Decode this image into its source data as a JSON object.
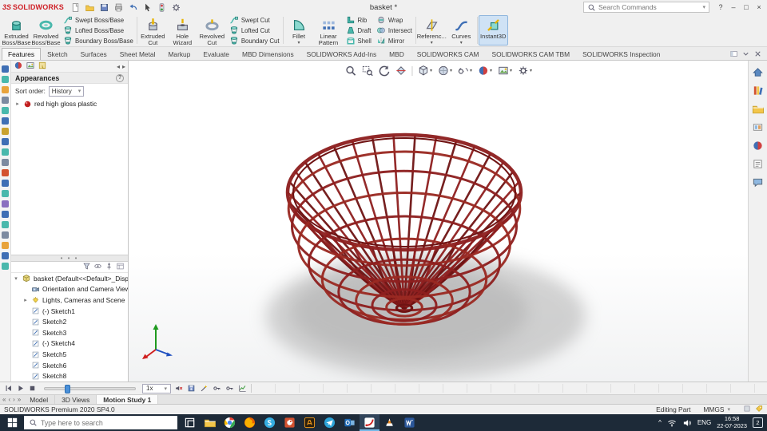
{
  "colors": {
    "basket": "#8e1f1f",
    "basket_dark": "#6f1313",
    "basket_mid": "#9a2a22",
    "shadow": "#a8a8a8",
    "taskbar": "#1d2a38",
    "accent_red": "#cf2027"
  },
  "titlebar": {
    "logo_prefix": "3S",
    "logo_text": "SOLIDWORKS",
    "doc_title": "basket *",
    "search_placeholder": "Search Commands",
    "menu_icons": [
      "new-document",
      "open",
      "save",
      "print",
      "undo",
      "select",
      "rebuild",
      "options"
    ],
    "window_buttons": [
      {
        "name": "help",
        "glyph": "?"
      },
      {
        "name": "minimize",
        "glyph": "–"
      },
      {
        "name": "maximize",
        "glyph": "□"
      },
      {
        "name": "close",
        "glyph": "×"
      }
    ]
  },
  "ribbon": {
    "groups": [
      {
        "type": "big",
        "label": "Extruded Boss/Base",
        "icon": "extruded-boss"
      },
      {
        "type": "big",
        "label": "Revolved Boss/Base",
        "icon": "revolved-boss"
      },
      {
        "type": "stack",
        "sep": true,
        "items": [
          {
            "label": "Swept Boss/Base",
            "icon": "swept-boss"
          },
          {
            "label": "Lofted Boss/Base",
            "icon": "lofted-boss"
          },
          {
            "label": "Boundary Boss/Base",
            "icon": "boundary-boss"
          }
        ]
      },
      {
        "type": "big",
        "label": "Extruded Cut",
        "icon": "extruded-cut",
        "arrow": true
      },
      {
        "type": "big",
        "label": "Hole Wizard",
        "icon": "hole-wizard",
        "arrow": true
      },
      {
        "type": "big",
        "label": "Revolved Cut",
        "icon": "revolved-cut",
        "arrow": true
      },
      {
        "type": "stack",
        "sep": true,
        "items": [
          {
            "label": "Swept Cut",
            "icon": "swept-cut"
          },
          {
            "label": "Lofted Cut",
            "icon": "lofted-cut"
          },
          {
            "label": "Boundary Cut",
            "icon": "boundary-cut"
          }
        ]
      },
      {
        "type": "big",
        "label": "Fillet",
        "icon": "fillet",
        "arrow": true
      },
      {
        "type": "big",
        "label": "Linear Pattern",
        "icon": "linear-pattern",
        "arrow": true
      },
      {
        "type": "stack",
        "items": [
          {
            "label": "Rib",
            "icon": "rib"
          },
          {
            "label": "Draft",
            "icon": "draft"
          },
          {
            "label": "Shell",
            "icon": "shell"
          }
        ]
      },
      {
        "type": "stack",
        "sep": true,
        "items": [
          {
            "label": "Wrap",
            "icon": "wrap"
          },
          {
            "label": "Intersect",
            "icon": "intersect"
          },
          {
            "label": "Mirror",
            "icon": "mirror"
          }
        ]
      },
      {
        "type": "big",
        "label": "Referenc...",
        "icon": "reference-geometry",
        "arrow": true
      },
      {
        "type": "big",
        "label": "Curves",
        "icon": "curves",
        "arrow": true,
        "sep": true
      },
      {
        "type": "big",
        "label": "Instant3D",
        "icon": "instant3d",
        "active": true
      }
    ]
  },
  "ribbon_tabs": {
    "active": "Features",
    "items": [
      "Features",
      "Sketch",
      "Surfaces",
      "Sheet Metal",
      "Markup",
      "Evaluate",
      "MBD Dimensions",
      "SOLIDWORKS Add-Ins",
      "MBD",
      "SOLIDWORKS CAM",
      "SOLIDWORKS CAM TBM",
      "SOLIDWORKS Inspection"
    ],
    "pane_icons": [
      "dock-pane",
      "collapse-ribbon",
      "close-pane"
    ]
  },
  "left_toolbar": {
    "count": 20
  },
  "appearances_panel": {
    "tab_icons": [
      "appearance-ball",
      "scene",
      "decal"
    ],
    "tab_nav": [
      "◂",
      "▸"
    ],
    "title": "Appearances",
    "help_glyph": "?",
    "sort_label": "Sort order:",
    "sort_value": "History",
    "items": [
      {
        "label": "red high gloss plastic",
        "icon": "red-sphere"
      }
    ]
  },
  "feature_tree": {
    "toolbar_icons": [
      "filter",
      "eye",
      "pin",
      "display-pane"
    ],
    "root": {
      "label": "basket  (Default<<Default>_Displ...",
      "icon": "part",
      "expander": "▾"
    },
    "items": [
      {
        "label": "Orientation and Camera Views",
        "icon": "camera"
      },
      {
        "label": "Lights, Cameras and Scene",
        "icon": "lights",
        "expander": "▸"
      },
      {
        "label": "(-) Sketch1",
        "icon": "sketch"
      },
      {
        "label": "Sketch2",
        "icon": "sketch"
      },
      {
        "label": "Sketch3",
        "icon": "sketch"
      },
      {
        "label": "(-) Sketch4",
        "icon": "sketch"
      },
      {
        "label": "Sketch5",
        "icon": "sketch"
      },
      {
        "label": "Sketch6",
        "icon": "sketch"
      },
      {
        "label": "Sketch8",
        "icon": "sketch"
      }
    ]
  },
  "viewport": {
    "model_name": "basket",
    "toolbar_icons": [
      {
        "name": "zoom-fit"
      },
      {
        "name": "zoom-area"
      },
      {
        "name": "previous-view"
      },
      {
        "name": "section-view",
        "sep": true
      },
      {
        "name": "view-orientation",
        "arrow": true
      },
      {
        "name": "display-style",
        "arrow": true
      },
      {
        "name": "hide-show-items",
        "arrow": true
      },
      {
        "name": "edit-appearance",
        "arrow": true
      },
      {
        "name": "apply-scene",
        "arrow": true
      },
      {
        "name": "view-settings",
        "arrow": true
      }
    ]
  },
  "task_pane": {
    "icons": [
      "home",
      "design-library",
      "file-explorer",
      "view-palette",
      "appearances-scenes",
      "custom-properties",
      "forum"
    ]
  },
  "motion_bar": {
    "transport_icons": [
      "jump-start",
      "play",
      "stop"
    ],
    "speed_value": "1x",
    "tool_icons": [
      "sound-off",
      "save-animation",
      "animation-wizard",
      "auto-key",
      "add-key",
      "graph"
    ]
  },
  "document_tabs": {
    "nav_glyphs": [
      "«",
      "‹",
      "›",
      "»"
    ],
    "items": [
      "Model",
      "3D Views",
      "Motion Study 1"
    ],
    "active": "Motion Study 1"
  },
  "statusbar": {
    "left": "SOLIDWORKS Premium 2020 SP4.0",
    "editing": "Editing Part",
    "units": "MMGS",
    "icons": [
      "custom-status",
      "tag"
    ]
  },
  "taskbar": {
    "search_placeholder": "Type here to search",
    "apps": [
      "task-view",
      "file-explorer",
      "chrome",
      "firefox",
      "skype",
      "powerpoint",
      "illustrator",
      "telegram",
      "outlook",
      "solidworks",
      "vlc",
      "word"
    ],
    "active_app": "solidworks",
    "tray": {
      "chevron": "^",
      "language": "ENG",
      "time": "16:58",
      "date": "22-07-2023",
      "badge": "2"
    }
  }
}
